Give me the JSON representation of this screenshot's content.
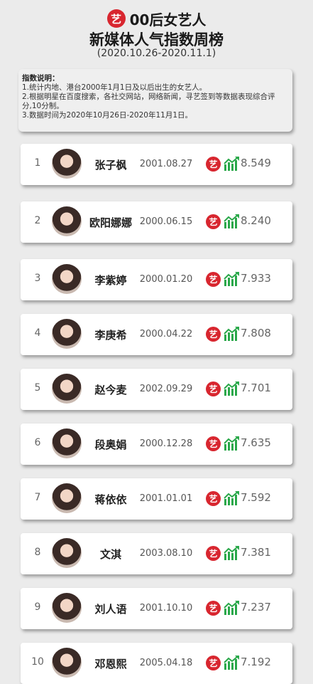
{
  "header": {
    "logo_char": "艺",
    "title_line1": "00后女艺人",
    "title_line2": "新媒体人气指数周榜",
    "date_range": "(2020.10.26-2020.11.1)"
  },
  "notes": {
    "title": "指数说明：",
    "lines": [
      "1.统计内地、港台2000年1月1日及以后出生的女艺人。",
      "2.根据明星在百度搜索，各社交网站，网络新闻，寻艺签到等数据表现综合评分,10分制。",
      "3.数据时间为2020年10月26日-2020年11月1日。"
    ]
  },
  "icons": {
    "brand": "yi-logo-icon",
    "trend": "trend-up-chart-icon"
  },
  "colors": {
    "brand_red": "#d8262f",
    "trend_green": "#2aa84a"
  },
  "rankings": [
    {
      "rank": "1",
      "name": "张子枫",
      "birth": "2001.08.27",
      "score": "8.549"
    },
    {
      "rank": "2",
      "name": "欧阳娜娜",
      "birth": "2000.06.15",
      "score": "8.240"
    },
    {
      "rank": "3",
      "name": "李紫婷",
      "birth": "2000.01.20",
      "score": "7.933"
    },
    {
      "rank": "4",
      "name": "李庚希",
      "birth": "2000.04.22",
      "score": "7.808"
    },
    {
      "rank": "5",
      "name": "赵今麦",
      "birth": "2002.09.29",
      "score": "7.701"
    },
    {
      "rank": "6",
      "name": "段奥娟",
      "birth": "2000.12.28",
      "score": "7.635"
    },
    {
      "rank": "7",
      "name": "蒋依依",
      "birth": "2001.01.01",
      "score": "7.592"
    },
    {
      "rank": "8",
      "name": "文淇",
      "birth": "2003.08.10",
      "score": "7.381"
    },
    {
      "rank": "9",
      "name": "刘人语",
      "birth": "2001.10.10",
      "score": "7.237"
    },
    {
      "rank": "10",
      "name": "邓恩熙",
      "birth": "2005.04.18",
      "score": "7.192"
    }
  ]
}
